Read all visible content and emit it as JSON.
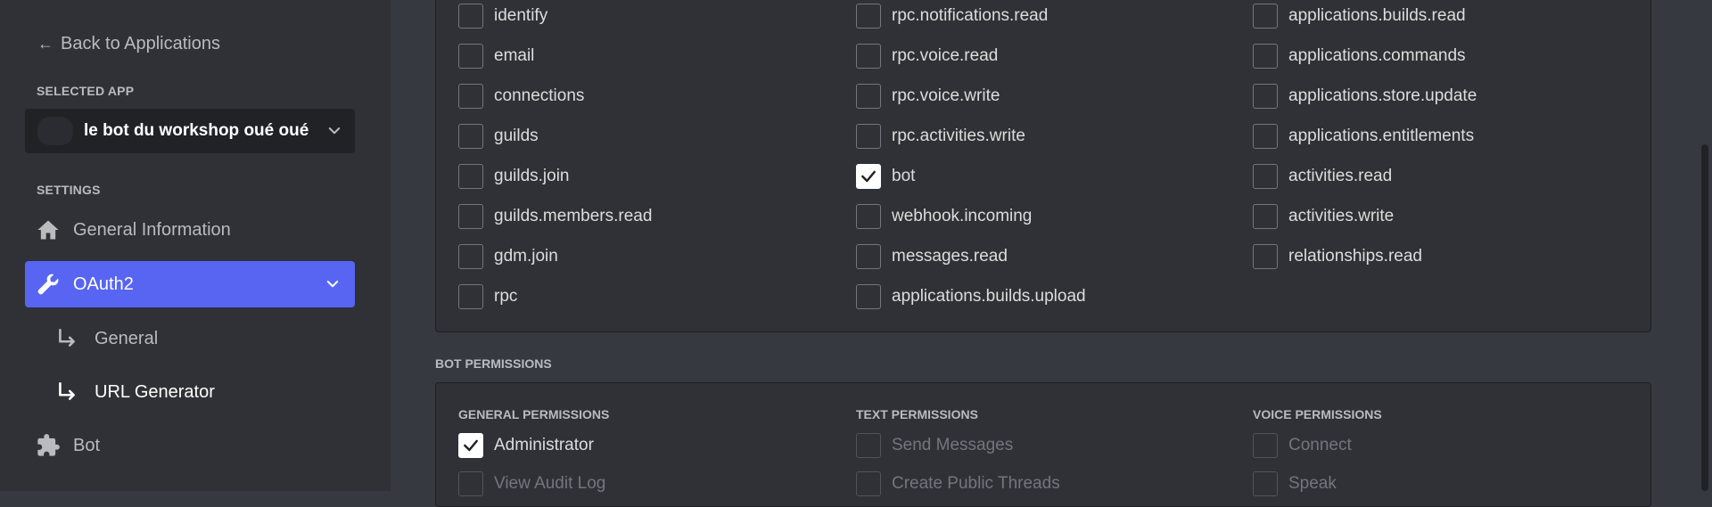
{
  "sidebar": {
    "back_label": "Back to Applications",
    "selected_app_label": "SELECTED APP",
    "app_name": "le bot du workshop oué oué",
    "settings_label": "SETTINGS",
    "items": [
      {
        "label": "General Information",
        "icon": "home-icon"
      },
      {
        "label": "OAuth2",
        "icon": "wrench-icon",
        "active": true
      },
      {
        "label": "Bot",
        "icon": "puzzle-icon"
      }
    ],
    "sub_items": [
      {
        "label": "General"
      },
      {
        "label": "URL Generator",
        "active": true
      }
    ]
  },
  "scopes": {
    "col1": [
      "identify",
      "email",
      "connections",
      "guilds",
      "guilds.join",
      "guilds.members.read",
      "gdm.join",
      "rpc"
    ],
    "col2": [
      "rpc.notifications.read",
      "rpc.voice.read",
      "rpc.voice.write",
      "rpc.activities.write",
      "bot",
      "webhook.incoming",
      "messages.read",
      "applications.builds.upload"
    ],
    "col3": [
      "applications.builds.read",
      "applications.commands",
      "applications.store.update",
      "applications.entitlements",
      "activities.read",
      "activities.write",
      "relationships.read"
    ],
    "checked": [
      "bot"
    ]
  },
  "bot_permissions": {
    "title": "BOT PERMISSIONS",
    "general_title": "GENERAL PERMISSIONS",
    "text_title": "TEXT PERMISSIONS",
    "voice_title": "VOICE PERMISSIONS",
    "general": [
      "Administrator",
      "View Audit Log"
    ],
    "text": [
      "Send Messages",
      "Create Public Threads"
    ],
    "voice": [
      "Connect",
      "Speak"
    ],
    "checked": [
      "Administrator"
    ]
  },
  "colors": {
    "accent": "#5865f2",
    "sidebar_bg": "#2f3136",
    "main_bg": "#36393f"
  }
}
